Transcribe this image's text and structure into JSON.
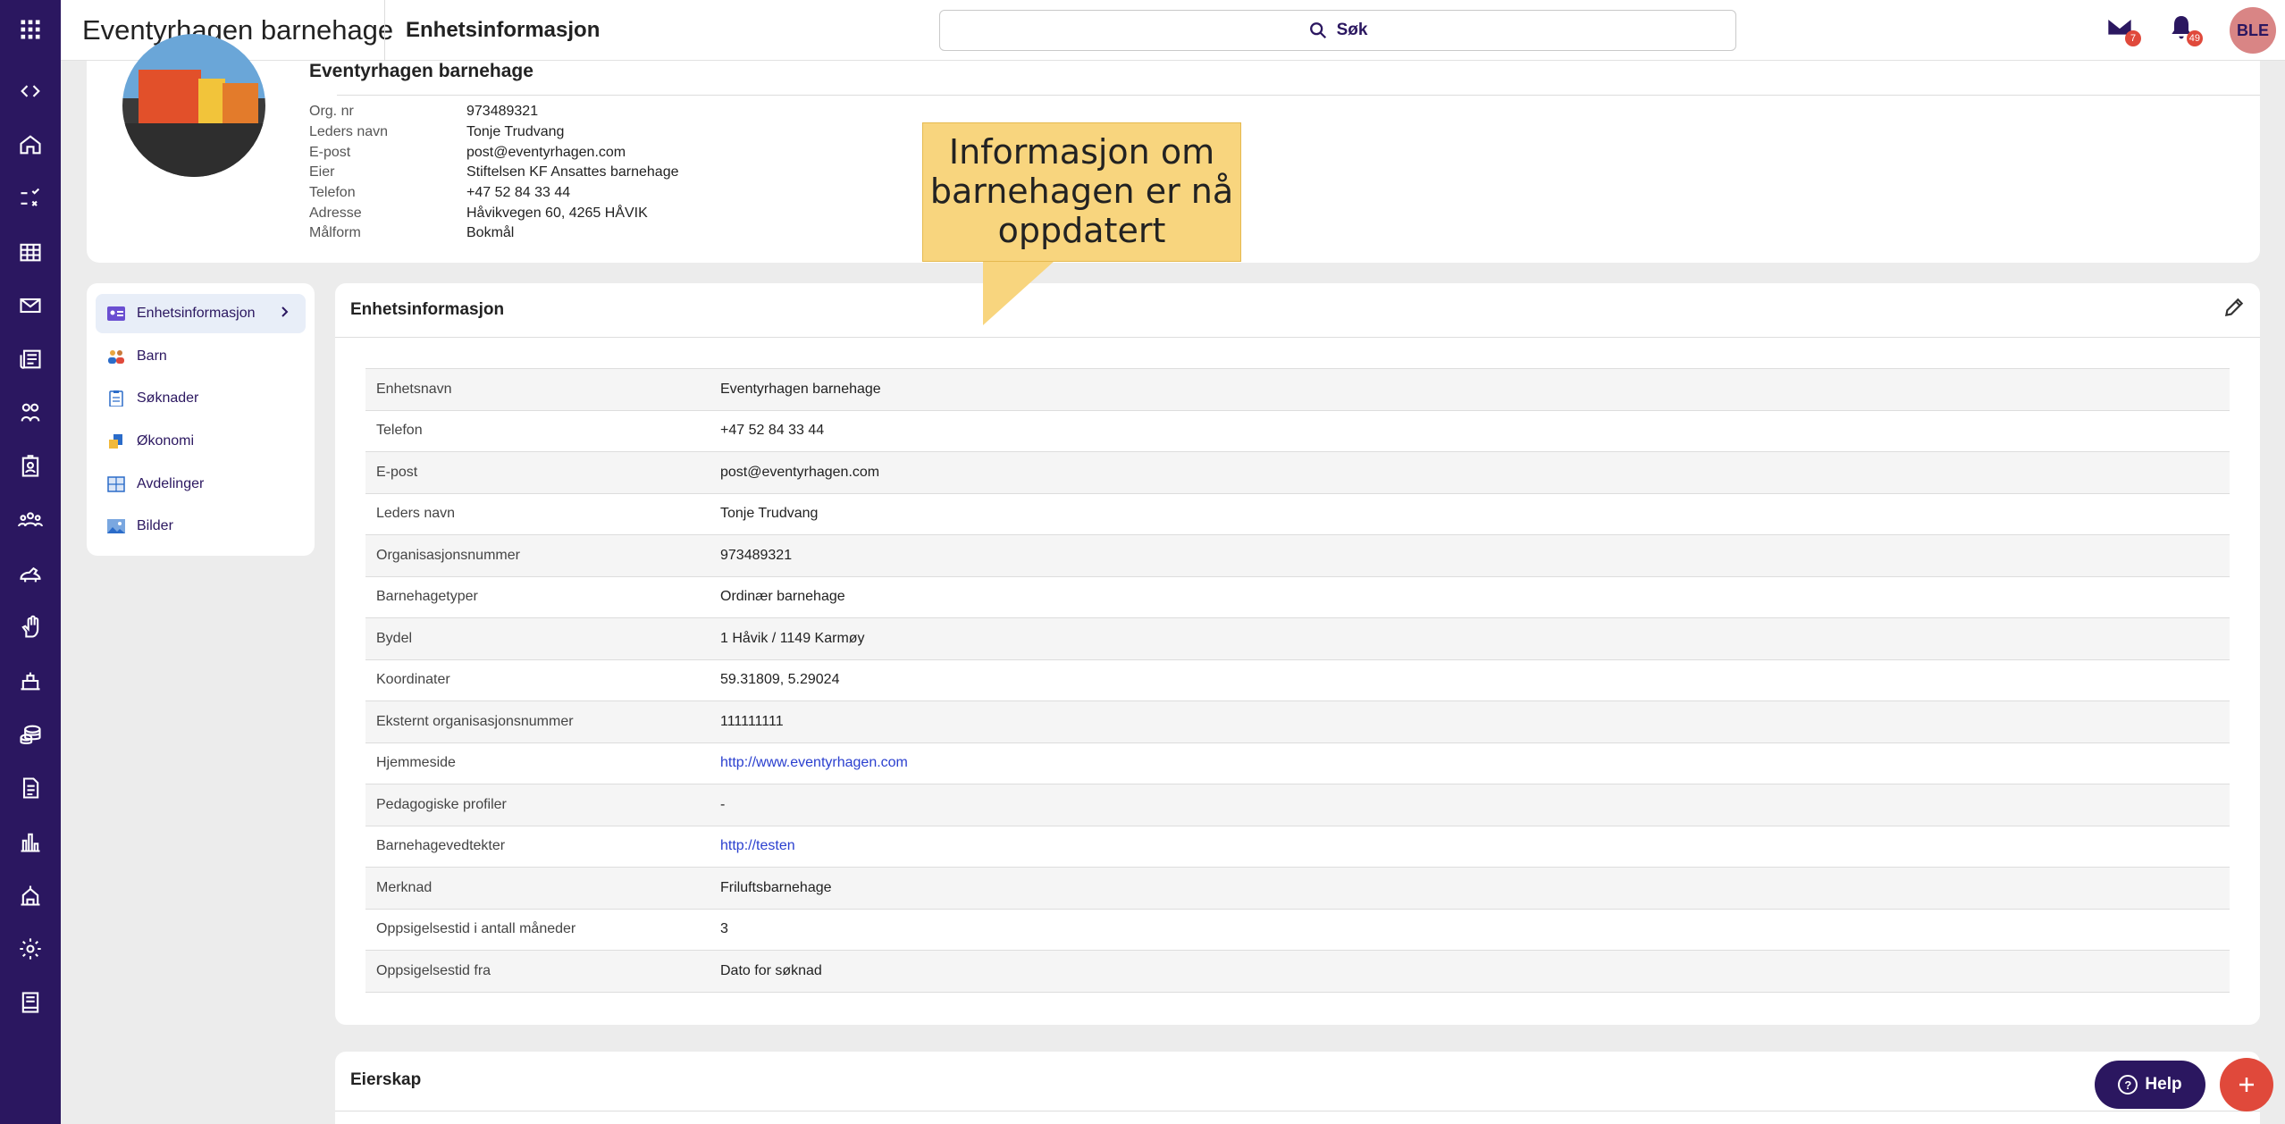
{
  "topbar": {
    "app_title": "Eventyrhagen barnehage",
    "page_title": "Enhetsinformasjon",
    "search_label": "Søk",
    "messages_count": "7",
    "notifications_count": "49",
    "user_initials": "BLE"
  },
  "rail": {
    "icons": [
      "apps-grid-icon",
      "expand-collapse-icon",
      "home-icon",
      "checklist-icon",
      "calendar-icon",
      "mail-icon",
      "news-icon",
      "children-icon",
      "badge-icon",
      "group-icon",
      "pets-icon",
      "hand-icon",
      "room-icon",
      "coins-icon",
      "document-icon",
      "chart-icon",
      "building-icon",
      "gear-icon",
      "book-icon"
    ]
  },
  "header": {
    "unit_name": "Eventyrhagen barnehage",
    "details": [
      {
        "label": "Org. nr",
        "value": "973489321"
      },
      {
        "label": "Leders navn",
        "value": "Tonje Trudvang"
      },
      {
        "label": "E-post",
        "value": "post@eventyrhagen.com"
      },
      {
        "label": "Eier",
        "value": "Stiftelsen KF Ansattes barnehage"
      },
      {
        "label": "Telefon",
        "value": "+47 52 84 33 44"
      },
      {
        "label": "Adresse",
        "value": "Håvikvegen 60, 4265 HÅVIK"
      },
      {
        "label": "Målform",
        "value": "Bokmål"
      }
    ]
  },
  "tooltip": {
    "text": "Informasjon om barnehagen er nå oppdatert"
  },
  "menu": {
    "items": [
      {
        "label": "Enhetsinformasjon",
        "icon": "id-card-icon",
        "active": true
      },
      {
        "label": "Barn",
        "icon": "children-icon"
      },
      {
        "label": "Søknader",
        "icon": "clipboard-icon"
      },
      {
        "label": "Økonomi",
        "icon": "coins-icon"
      },
      {
        "label": "Avdelinger",
        "icon": "floorplan-icon"
      },
      {
        "label": "Bilder",
        "icon": "image-icon"
      }
    ]
  },
  "main": {
    "title": "Enhetsinformasjon",
    "rows": [
      {
        "label": "Enhetsnavn",
        "value": "Eventyrhagen barnehage"
      },
      {
        "label": "Telefon",
        "value": "+47 52 84 33 44"
      },
      {
        "label": "E-post",
        "value": "post@eventyrhagen.com"
      },
      {
        "label": "Leders navn",
        "value": "Tonje Trudvang"
      },
      {
        "label": "Organisasjonsnummer",
        "value": "973489321"
      },
      {
        "label": "Barnehagetyper",
        "value": "Ordinær barnehage"
      },
      {
        "label": "Bydel",
        "value": "1 Håvik / 1149 Karmøy"
      },
      {
        "label": "Koordinater",
        "value": "59.31809, 5.29024"
      },
      {
        "label": "Eksternt organisasjonsnummer",
        "value": "111111111"
      },
      {
        "label": "Hjemmeside",
        "value": "http://www.eventyrhagen.com",
        "link": true
      },
      {
        "label": "Pedagogiske profiler",
        "value": "-"
      },
      {
        "label": "Barnehagevedtekter",
        "value": "http://testen",
        "link": true
      },
      {
        "label": "Merknad",
        "value": "Friluftsbarnehage"
      },
      {
        "label": "Oppsigelsestid i antall måneder",
        "value": "3"
      },
      {
        "label": "Oppsigelsestid fra",
        "value": "Dato for søknad"
      }
    ]
  },
  "owner": {
    "title": "Eierskap"
  },
  "floating": {
    "help_label": "Help"
  }
}
